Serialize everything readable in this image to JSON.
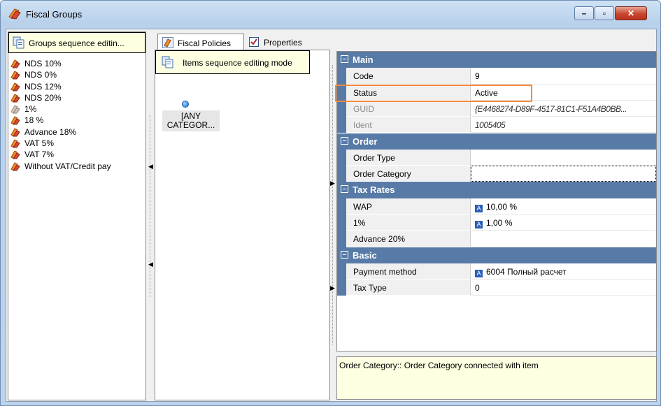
{
  "window": {
    "title": "Fiscal Groups"
  },
  "left_panel": {
    "header_label": "Groups sequence editin...",
    "groups": [
      {
        "label": "NDS 10%"
      },
      {
        "label": "NDS 0%"
      },
      {
        "label": "NDS 12%"
      },
      {
        "label": "NDS 20%"
      },
      {
        "label": "1%"
      },
      {
        "label": "18 %"
      },
      {
        "label": "Advance 18%"
      },
      {
        "label": "VAT 5%"
      },
      {
        "label": "VAT 7%"
      },
      {
        "label": "Without VAT/Credit pay"
      }
    ]
  },
  "tabs": [
    {
      "label": "Fiscal Policies"
    },
    {
      "label": "Properties"
    }
  ],
  "middle_panel": {
    "header_label": "Items sequence editing mode",
    "node_line1": "[ANY",
    "node_line2": "CATEGOR..."
  },
  "property_grid": {
    "categories": [
      {
        "label": "Main"
      },
      {
        "label": "Order"
      },
      {
        "label": "Tax Rates"
      },
      {
        "label": "Basic"
      }
    ],
    "properties": [
      {
        "name": "Code",
        "value": "9"
      },
      {
        "name": "Status",
        "value": "Active"
      },
      {
        "name": "GUID",
        "value": "{E4468274-D89F-4517-81C1-F51A4B0BB..."
      },
      {
        "name": "Ident",
        "value": "1005405"
      },
      {
        "name": "Order Type",
        "value": ""
      },
      {
        "name": "Order Category",
        "value": ""
      },
      {
        "name": "WAP",
        "value": "10,00 %"
      },
      {
        "name": "1%",
        "value": "1,00 %"
      },
      {
        "name": "Advance 20%",
        "value": ""
      },
      {
        "name": "Payment method",
        "value": "6004 Полный расчет"
      },
      {
        "name": "Tax Type",
        "value": "0"
      }
    ],
    "value_badge": "A"
  },
  "description": {
    "text": "Order Category:: Order Category connected with item"
  },
  "colors": {
    "category_bar": "#577aa6",
    "highlight": "#f08a3c",
    "info_bg": "#ffffe1"
  }
}
